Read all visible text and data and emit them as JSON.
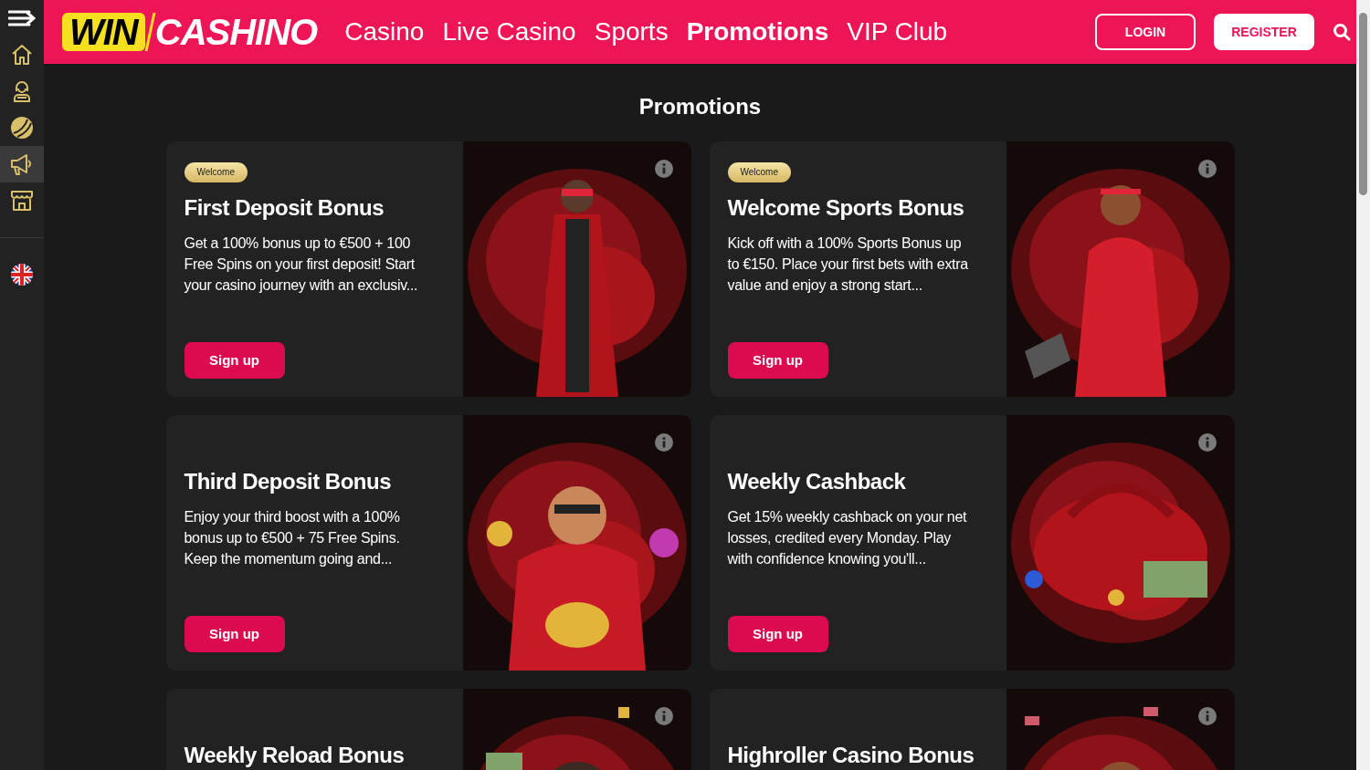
{
  "sidebar": {
    "items": [
      {
        "kind": "menu",
        "selected": false
      },
      {
        "kind": "home",
        "selected": false
      },
      {
        "kind": "casino",
        "selected": false
      },
      {
        "kind": "sports",
        "selected": false
      },
      {
        "kind": "promotions",
        "selected": true
      },
      {
        "kind": "shop",
        "selected": false
      },
      {
        "kind": "flag",
        "selected": false
      }
    ]
  },
  "header": {
    "logo": {
      "part_1": "WIN",
      "part_2": "CASHINO"
    },
    "nav": [
      {
        "label": "Casino",
        "selected": false
      },
      {
        "label": "Live Casino",
        "selected": false
      },
      {
        "label": "Sports",
        "selected": false
      },
      {
        "label": "Promotions",
        "selected": true
      },
      {
        "label": "VIP Club",
        "selected": false
      }
    ],
    "login": "LOGIN",
    "register": "REGISTER"
  },
  "page_title": "Promotions",
  "promotions": [
    {
      "badge": "Welcome",
      "title": "First Deposit Bonus",
      "description": "Get a 100% bonus up to €500 + 100 Free Spins on your first deposit! Start your casino journey with an exclusiv...",
      "button": "Sign up"
    },
    {
      "badge": "Welcome",
      "title": "Welcome Sports Bonus",
      "description": "Kick off with a 100% Sports Bonus up to €150. Place your first bets with extra value and enjoy a strong start...",
      "button": "Sign up"
    },
    {
      "title": "Third Deposit Bonus",
      "description": "Enjoy your third boost with a 100% bonus up to €500 + 75 Free Spins. Keep the momentum going and...",
      "button": "Sign up"
    },
    {
      "title": "Weekly Cashback",
      "description": "Get 15% weekly cashback on your net losses, credited every Monday. Play with confidence knowing you'll...",
      "button": "Sign up"
    },
    {
      "title": "Weekly Reload Bonus"
    },
    {
      "title": "Highroller Casino Bonus"
    }
  ]
}
